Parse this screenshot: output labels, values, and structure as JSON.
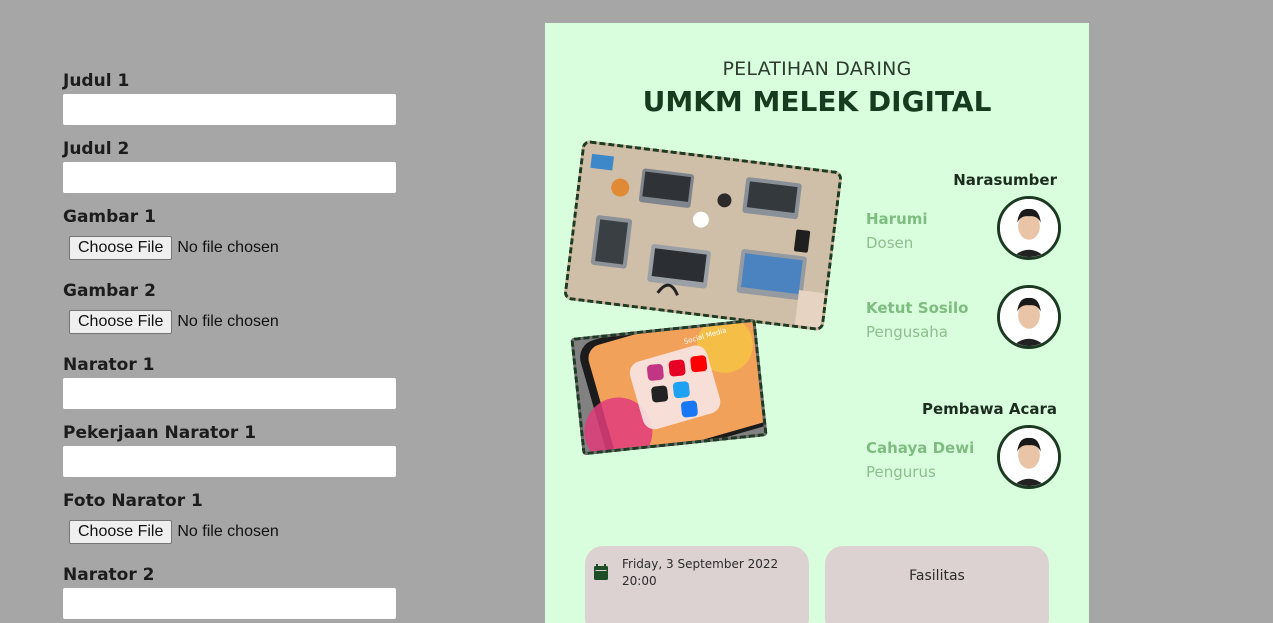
{
  "form": {
    "judul1": {
      "label": "Judul 1",
      "value": ""
    },
    "judul2": {
      "label": "Judul 2",
      "value": ""
    },
    "gambar1": {
      "label": "Gambar 1",
      "button": "Choose File",
      "status": "No file chosen"
    },
    "gambar2": {
      "label": "Gambar 2",
      "button": "Choose File",
      "status": "No file chosen"
    },
    "narator1": {
      "label": "Narator 1",
      "value": ""
    },
    "pekerjaan1": {
      "label": "Pekerjaan Narator 1",
      "value": ""
    },
    "foto1": {
      "label": "Foto Narator 1",
      "button": "Choose File",
      "status": "No file chosen"
    },
    "narator2": {
      "label": "Narator 2",
      "value": ""
    }
  },
  "poster": {
    "subtitle": "PELATIHAN DARING",
    "title": "UMKM MELEK DIGITAL",
    "speakers_heading": "Narasumber",
    "host_heading": "Pembawa Acara",
    "speakers": [
      {
        "name": "Harumi",
        "job": "Dosen"
      },
      {
        "name": "Ketut Sosilo",
        "job": "Pengusaha"
      }
    ],
    "host": {
      "name": "Cahaya Dewi",
      "job": "Pengurus"
    },
    "schedule": {
      "date": "Friday, 3 September 2022",
      "time": "20:00"
    },
    "facilities_label": "Fasilitas",
    "phone_app_label": "Social Media"
  },
  "colors": {
    "page_background": "#a6a6a6",
    "poster_background": "#d9fedd",
    "title_color": "#183a1f",
    "name_color": "#7fbc80",
    "card_background": "#dcd2d1"
  },
  "icons": {
    "calendar": "calendar-icon",
    "avatar": "person-portrait"
  }
}
